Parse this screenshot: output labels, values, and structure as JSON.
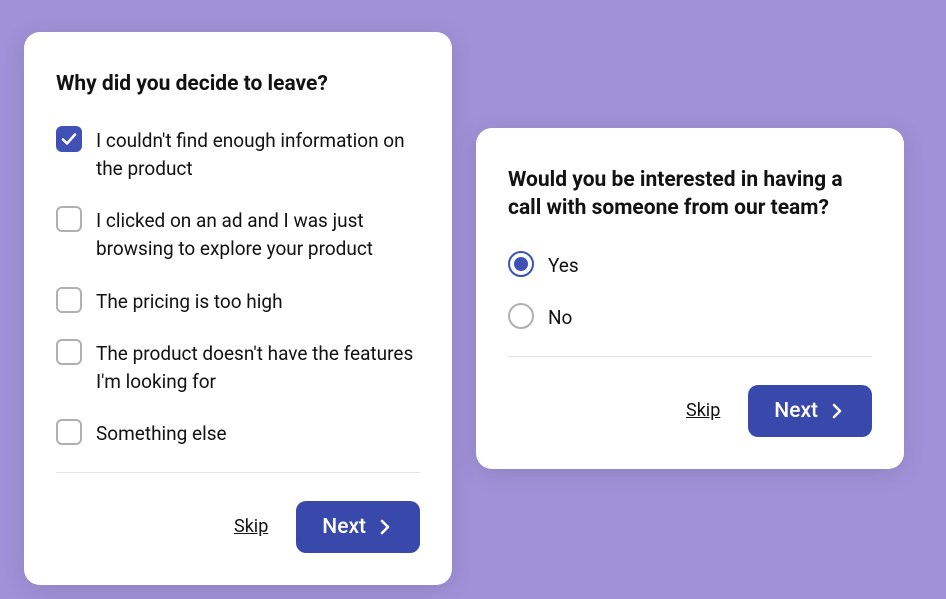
{
  "survey_left": {
    "question": "Why did you decide to leave?",
    "options": [
      {
        "label": "I couldn't find enough information on the product",
        "checked": true
      },
      {
        "label": "I clicked on an ad and I was just browsing to explore your product",
        "checked": false
      },
      {
        "label": "The pricing is too high",
        "checked": false
      },
      {
        "label": "The product doesn't have the features I'm looking for",
        "checked": false
      },
      {
        "label": "Something else",
        "checked": false
      }
    ],
    "skip_label": "Skip",
    "next_label": "Next"
  },
  "survey_right": {
    "question": "Would you be interested in having a call with someone from our team?",
    "options": [
      {
        "label": "Yes",
        "selected": true
      },
      {
        "label": "No",
        "selected": false
      }
    ],
    "skip_label": "Skip",
    "next_label": "Next"
  },
  "colors": {
    "background": "#a092d9",
    "primary": "#3949ab",
    "checkbox_fill": "#3f51b5"
  }
}
